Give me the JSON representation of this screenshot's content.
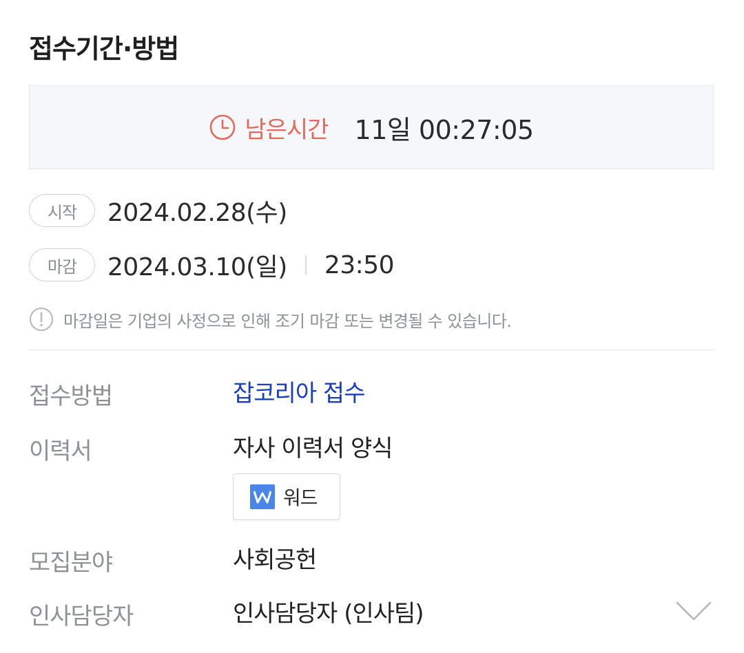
{
  "section": {
    "title": "접수기간·방법"
  },
  "countdown": {
    "label": "남은시간",
    "value": "11일 00:27:05"
  },
  "start": {
    "label": "시작",
    "date": "2024.02.28(수)"
  },
  "end": {
    "label": "마감",
    "date": "2024.03.10(일)",
    "time": "23:50"
  },
  "notice": {
    "text": "마감일은 기업의 사정으로 인해 조기 마감 또는 변경될 수 있습니다."
  },
  "details": {
    "method_label": "접수방법",
    "method_value": "잡코리아 접수",
    "resume_label": "이력서",
    "resume_value": "자사 이력서 양식",
    "resume_file_label": "워드",
    "field_label": "모집분야",
    "field_value": "사회공헌",
    "contact_label": "인사담당자",
    "contact_value": "인사담당자 (인사팀)"
  },
  "colors": {
    "accent_red": "#e06a5e",
    "link_blue": "#1a3fbd",
    "word_blue": "#4a86e8"
  },
  "icons": {
    "clock": "clock-icon",
    "notice": "exclamation-circle-icon",
    "word": "word-doc-icon",
    "expand": "chevron-down-icon"
  }
}
